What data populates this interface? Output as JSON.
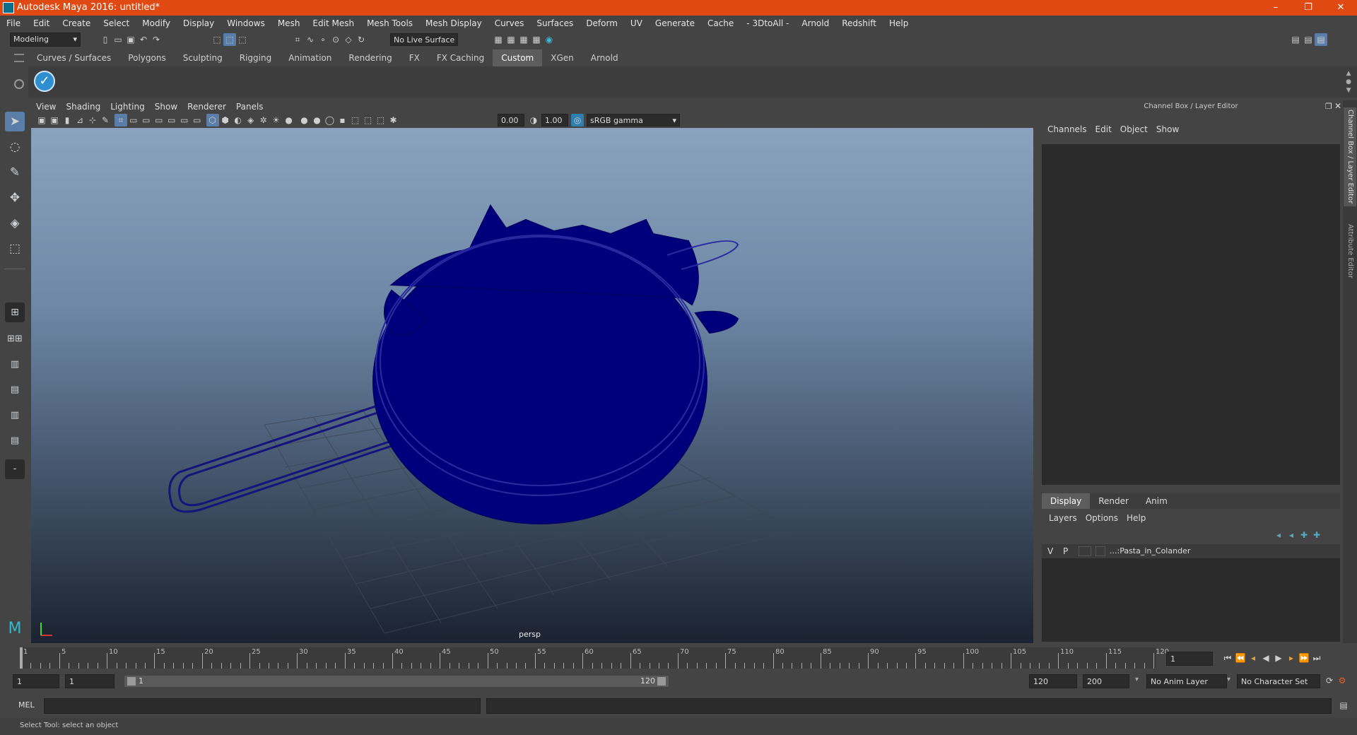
{
  "window": {
    "title": "Autodesk Maya 2016: untitled*",
    "minimize": "–",
    "restore": "❐",
    "close": "✕"
  },
  "menu": [
    "File",
    "Edit",
    "Create",
    "Select",
    "Modify",
    "Display",
    "Windows",
    "Mesh",
    "Edit Mesh",
    "Mesh Tools",
    "Mesh Display",
    "Curves",
    "Surfaces",
    "Deform",
    "UV",
    "Generate",
    "Cache",
    "- 3DtoAll -",
    "Arnold",
    "Redshift",
    "Help"
  ],
  "statusline": {
    "mode": "Modeling",
    "live_surface": "No Live Surface"
  },
  "shelf_tabs": [
    "Curves / Surfaces",
    "Polygons",
    "Sculpting",
    "Rigging",
    "Animation",
    "Rendering",
    "FX",
    "FX Caching",
    "Custom",
    "XGen",
    "Arnold"
  ],
  "shelf_active": "Custom",
  "viewport": {
    "menu": [
      "View",
      "Shading",
      "Lighting",
      "Show",
      "Renderer",
      "Panels"
    ],
    "exposure": "0.00",
    "gamma": "1.00",
    "colorspace": "sRGB gamma",
    "camera_label": "persp"
  },
  "channelbox": {
    "title": "Channel Box / Layer Editor",
    "menu": [
      "Channels",
      "Edit",
      "Object",
      "Show"
    ]
  },
  "layereditor": {
    "tabs": [
      "Display",
      "Render",
      "Anim"
    ],
    "active_tab": "Display",
    "menu": [
      "Layers",
      "Options",
      "Help"
    ],
    "layer": {
      "v": "V",
      "p": "P",
      "name": "...:Pasta_in_Colander"
    }
  },
  "side_tabs": [
    "Channel Box / Layer Editor",
    "Attribute Editor"
  ],
  "timeline": {
    "ticks": [
      "1",
      "5",
      "10",
      "15",
      "20",
      "25",
      "30",
      "35",
      "40",
      "45",
      "50",
      "55",
      "60",
      "65",
      "70",
      "75",
      "80",
      "85",
      "90",
      "95",
      "100",
      "105",
      "110",
      "115",
      "120"
    ],
    "current_frame": "1"
  },
  "range": {
    "start": "1",
    "anim_start": "1",
    "slider_start": "1",
    "slider_end": "120",
    "end": "120",
    "anim_end": "200",
    "anim_layer": "No Anim Layer",
    "char_set": "No Character Set"
  },
  "cmdline": {
    "label": "MEL"
  },
  "help": "Select Tool: select an object"
}
